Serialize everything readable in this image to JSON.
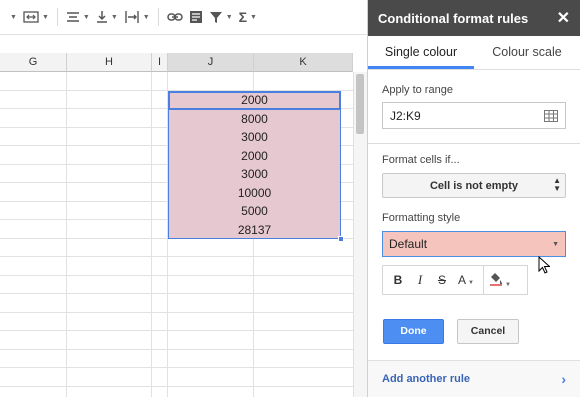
{
  "toolbar": {
    "items": [
      {
        "name": "merge-cells-icon"
      },
      {
        "name": "align-horizontal-icon"
      },
      {
        "name": "align-vertical-icon"
      },
      {
        "name": "text-wrap-icon"
      },
      {
        "name": "insert-link-icon"
      },
      {
        "name": "insert-comment-icon"
      },
      {
        "name": "filter-icon"
      },
      {
        "name": "functions-icon",
        "glyph": "Σ"
      }
    ]
  },
  "sheet": {
    "columns": [
      "G",
      "H",
      "I",
      "J",
      "K"
    ],
    "selected_range_values": [
      "2000",
      "8000",
      "3000",
      "2000",
      "3000",
      "10000",
      "5000",
      "28137"
    ],
    "selection_color": "#e6c8d0",
    "selection_border_color": "#4a7fe0"
  },
  "panel": {
    "title": "Conditional format rules",
    "close_glyph": "✕",
    "tabs": [
      "Single colour",
      "Colour scale"
    ],
    "active_tab": "Single colour",
    "apply_to_range": {
      "label": "Apply to range",
      "value": "J2:K9"
    },
    "format_cells_if": {
      "label": "Format cells if...",
      "selected": "Cell is not empty"
    },
    "formatting_style": {
      "label": "Formatting style",
      "selected": "Default",
      "swatch_color": "#f4c4bd",
      "buttons": [
        {
          "name": "bold-button",
          "glyph": "B"
        },
        {
          "name": "italic-button",
          "glyph": "I"
        },
        {
          "name": "strikethrough-button",
          "glyph": "S"
        },
        {
          "name": "text-color-button",
          "glyph": "A"
        },
        {
          "name": "fill-color-button",
          "glyph": ""
        }
      ]
    },
    "done_label": "Done",
    "cancel_label": "Cancel",
    "add_rule_label": "Add another rule",
    "accent_color": "#4285f4"
  }
}
